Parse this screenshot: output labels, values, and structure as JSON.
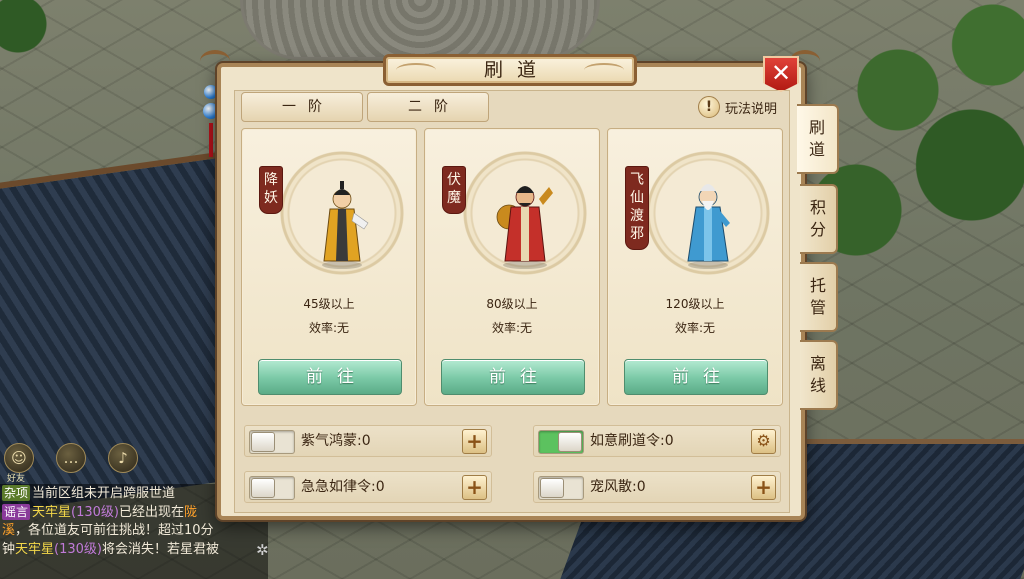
{
  "dialog": {
    "title": "刷道",
    "close_icon": "close-x-icon",
    "tiers": [
      "一阶",
      "二阶"
    ],
    "rules_label": "玩法说明",
    "rules_icon": "exclamation-icon",
    "cards": [
      {
        "name": "降妖",
        "name_chars": [
          "降",
          "妖"
        ],
        "level": "45级以上",
        "efficiency": "效率:无",
        "button": "前往",
        "figure_color": "#e1a322"
      },
      {
        "name": "伏魔",
        "name_chars": [
          "伏",
          "魔"
        ],
        "level": "80级以上",
        "efficiency": "效率:无",
        "button": "前往",
        "figure_color": "#c4302a"
      },
      {
        "name": "飞仙渡邪",
        "name_chars": [
          "飞",
          "仙",
          "渡",
          "邪"
        ],
        "level": "120级以上",
        "efficiency": "效率:无",
        "button": "前往",
        "figure_color": "#3f9ad0"
      }
    ],
    "options": [
      {
        "label": "紫气鸿蒙:0",
        "toggle": "off",
        "action_icon": "plus-icon"
      },
      {
        "label": "如意刷道令:0",
        "toggle": "on",
        "action_icon": "gear-icon"
      },
      {
        "label": "急急如律令:0",
        "toggle": "off",
        "action_icon": "plus-icon"
      },
      {
        "label": "宠风散:0",
        "toggle": "off",
        "action_icon": "plus-icon"
      }
    ],
    "side_tabs": [
      {
        "chars": [
          "刷",
          "道"
        ],
        "active": true
      },
      {
        "chars": [
          "积",
          "分"
        ],
        "active": false
      },
      {
        "chars": [
          "托",
          "管"
        ],
        "active": false
      },
      {
        "chars": [
          "离",
          "线"
        ],
        "active": false
      }
    ]
  },
  "hud": {
    "icon_label": "好友",
    "chat": {
      "line1": {
        "tag": "杂项",
        "text": "当前区组未开启跨服世道"
      },
      "line2": {
        "tag": "谣言",
        "name": "天牢星",
        "level": "(130级)",
        "text": "已经出现在",
        "place": "陇"
      },
      "line3": {
        "place_end": "溪",
        "text": "，各位道友可前往挑战！超过10分"
      },
      "line4": {
        "prefix": "钟",
        "name": "天牢星",
        "level": "(130级)",
        "text": "将会消失！若星君被"
      }
    }
  },
  "colors": {
    "go_button": "#79c8a5",
    "card_name_banner": "#7e2a1f",
    "close_button": "#c62a20",
    "toggle_on": "#5cc25f"
  }
}
